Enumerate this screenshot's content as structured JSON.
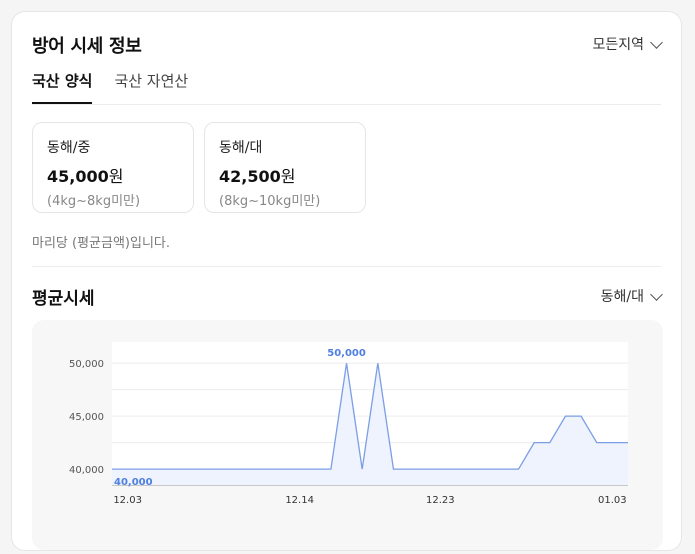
{
  "header": {
    "title": "방어 시세 정보",
    "region_label": "모든지역"
  },
  "tabs": [
    {
      "label": "국산 양식"
    },
    {
      "label": "국산 자연산"
    }
  ],
  "prices": [
    {
      "name": "동해/중",
      "value": "45,000",
      "unit": "원",
      "range": "(4kg~8kg미만)"
    },
    {
      "name": "동해/대",
      "value": "42,500",
      "unit": "원",
      "range": "(8kg~10kg미만)"
    }
  ],
  "note": "마리당 (평균금액)입니다.",
  "average": {
    "title": "평균시세",
    "selected": "동해/대"
  },
  "colors": {
    "line": "#7c9ee6",
    "fill": "#eef3fd",
    "label": "#4f7fe0"
  },
  "chart_data": {
    "type": "area",
    "x_ticks": [
      "12.03",
      "12.14",
      "12.23",
      "01.03"
    ],
    "y_ticks": [
      "40,000",
      "45,000",
      "50,000"
    ],
    "ylim": [
      38500,
      52000
    ],
    "values": [
      40000,
      40000,
      40000,
      40000,
      40000,
      40000,
      40000,
      40000,
      40000,
      40000,
      40000,
      40000,
      40000,
      40000,
      40000,
      50000,
      40000,
      50000,
      40000,
      40000,
      40000,
      40000,
      40000,
      40000,
      40000,
      40000,
      40000,
      42500,
      42500,
      45000,
      45000,
      42500,
      42500,
      42500
    ],
    "annotations": [
      {
        "text": "50,000",
        "index": 15
      },
      {
        "text": "40,000",
        "index": 0
      }
    ]
  }
}
